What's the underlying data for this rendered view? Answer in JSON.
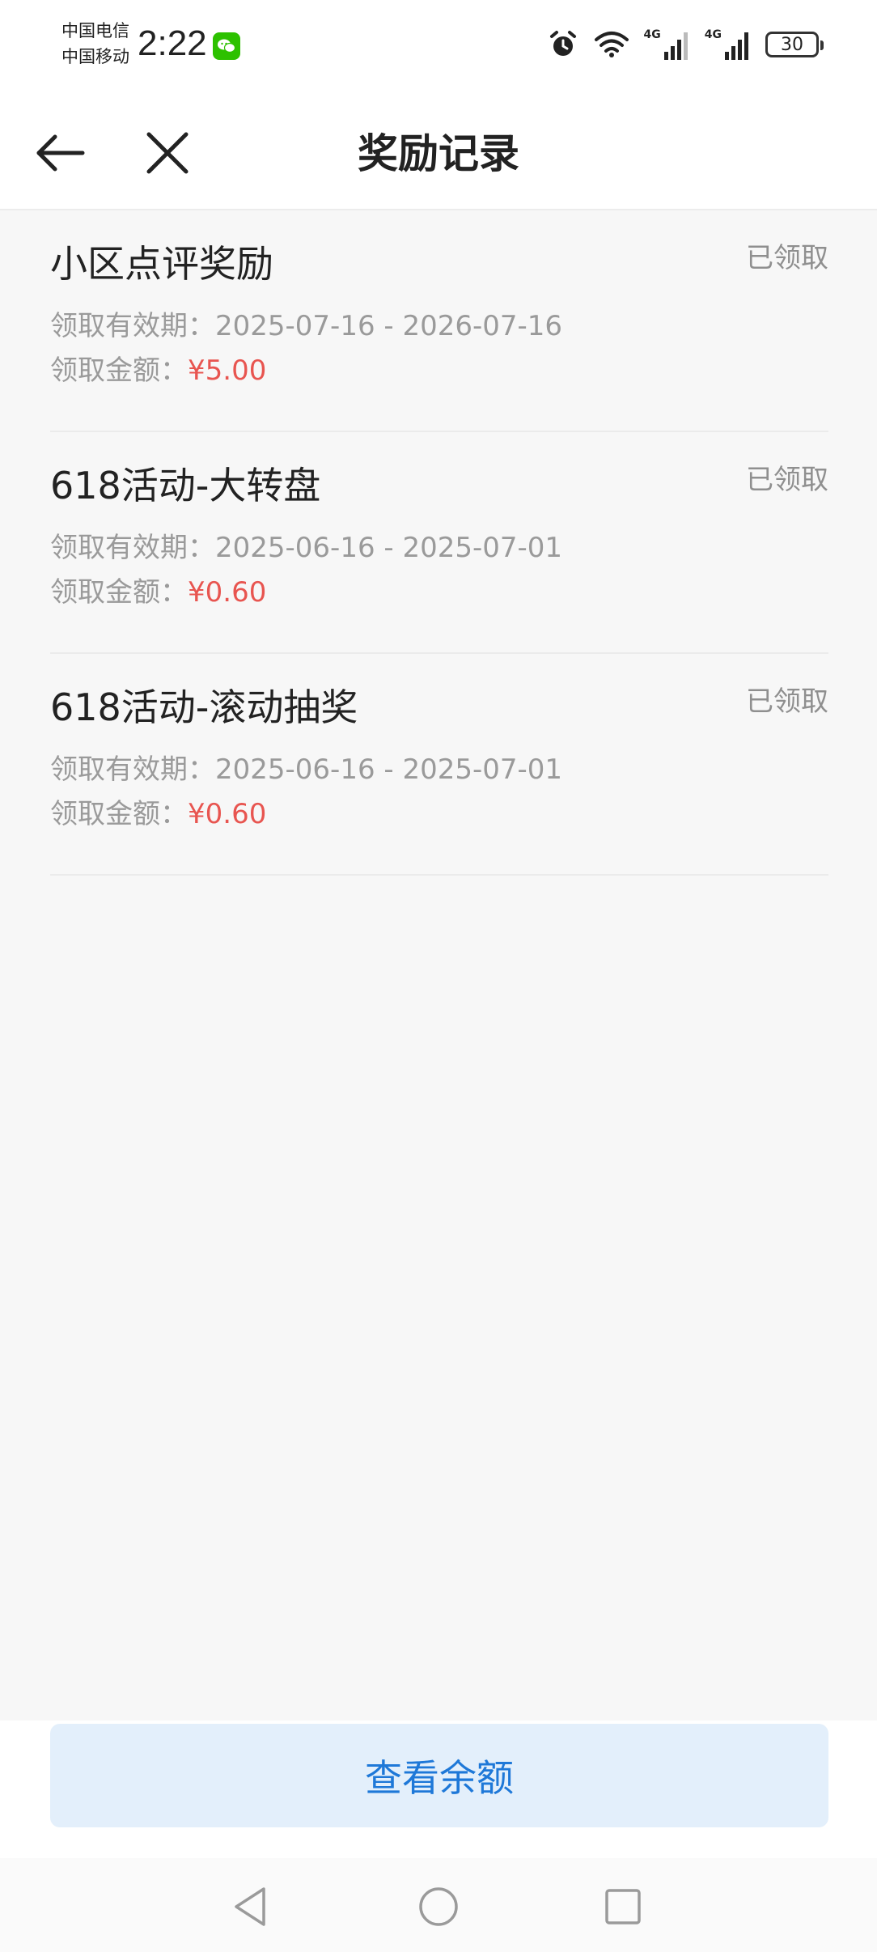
{
  "status_bar": {
    "carrier1": "中国电信",
    "carrier2": "中国移动",
    "time": "2:22",
    "network1": "4G",
    "network2": "4G",
    "battery": "30"
  },
  "header": {
    "title": "奖励记录"
  },
  "records": [
    {
      "title": "小区点评奖励",
      "status": "已领取",
      "validity_label": "领取有效期：",
      "validity": "2025-07-16 - 2026-07-16",
      "amount_label": "领取金额：",
      "amount": "¥5.00"
    },
    {
      "title": "618活动-大转盘",
      "status": "已领取",
      "validity_label": "领取有效期：",
      "validity": "2025-06-16 - 2025-07-01",
      "amount_label": "领取金额：",
      "amount": "¥0.60"
    },
    {
      "title": "618活动-滚动抽奖",
      "status": "已领取",
      "validity_label": "领取有效期：",
      "validity": "2025-06-16 - 2025-07-01",
      "amount_label": "领取金额：",
      "amount": "¥0.60"
    }
  ],
  "footer": {
    "button_label": "查看余额"
  },
  "colors": {
    "accent": "#1e78d8",
    "button_bg": "#e3effb",
    "amount": "#e85550",
    "wechat": "#2dc100"
  }
}
